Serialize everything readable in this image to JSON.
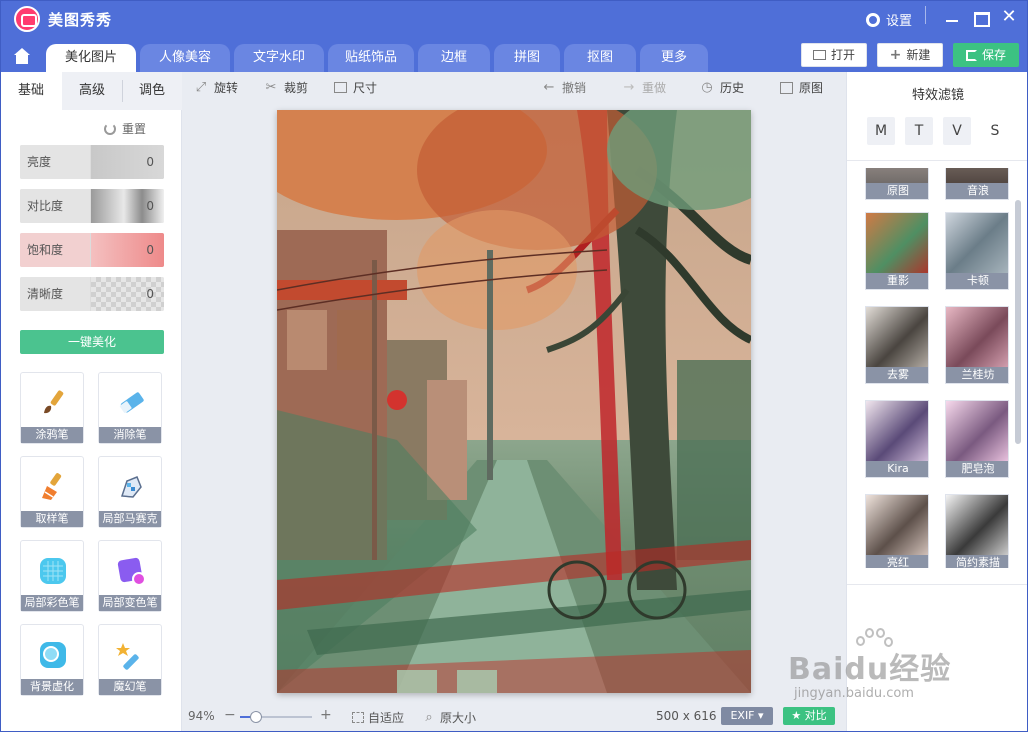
{
  "app": {
    "title": "美图秀秀",
    "settings_label": "设置"
  },
  "tabs": [
    {
      "label": "美化图片",
      "active": true
    },
    {
      "label": "人像美容"
    },
    {
      "label": "文字水印"
    },
    {
      "label": "贴纸饰品"
    },
    {
      "label": "边框"
    },
    {
      "label": "拼图"
    },
    {
      "label": "抠图"
    },
    {
      "label": "更多"
    }
  ],
  "top_buttons": {
    "open": "打开",
    "new": "新建",
    "save": "保存"
  },
  "left": {
    "subtabs": [
      "基础",
      "高级",
      "调色"
    ],
    "reset_label": "重置",
    "sliders": [
      {
        "label": "亮度",
        "value": "0"
      },
      {
        "label": "对比度",
        "value": "0"
      },
      {
        "label": "饱和度",
        "value": "0"
      },
      {
        "label": "清晰度",
        "value": "0"
      }
    ],
    "one_click_label": "一键美化",
    "tools": [
      {
        "label": "涂鸦笔",
        "icon": "brush-icon"
      },
      {
        "label": "消除笔",
        "icon": "eraser-icon"
      },
      {
        "label": "取样笔",
        "icon": "sample-brush-icon"
      },
      {
        "label": "局部马赛克",
        "icon": "mosaic-pen-icon"
      },
      {
        "label": "局部彩色笔",
        "icon": "color-pen-icon"
      },
      {
        "label": "局部变色笔",
        "icon": "recolor-pen-icon"
      },
      {
        "label": "背景虚化",
        "icon": "blur-bg-icon"
      },
      {
        "label": "魔幻笔",
        "icon": "magic-pen-icon"
      }
    ]
  },
  "toolbar": {
    "rotate": "旋转",
    "crop": "裁剪",
    "size": "尺寸",
    "undo": "撤销",
    "redo": "重做",
    "history": "历史",
    "original": "原图"
  },
  "status": {
    "zoom": "94%",
    "zoom_fraction": 0.22,
    "fit": "自适应",
    "actual_size": "原大小",
    "image_size": "500 x 616",
    "exif": "EXIF",
    "compare": "对比"
  },
  "right": {
    "title": "特效滤镜",
    "tabs": [
      "M",
      "T",
      "V",
      "S"
    ],
    "filters": [
      {
        "label": "原图"
      },
      {
        "label": "音浪"
      },
      {
        "label": "重影"
      },
      {
        "label": "卡顿"
      },
      {
        "label": "去雾"
      },
      {
        "label": "兰桂坊"
      },
      {
        "label": "Kira"
      },
      {
        "label": "肥皂泡"
      },
      {
        "label": "亮红"
      },
      {
        "label": "简约素描"
      }
    ]
  },
  "watermark": {
    "main": "Baidu经验",
    "sub": "jingyan.baidu.com"
  },
  "colors": {
    "brand": "#4f6fd8",
    "accent_green": "#3cc282",
    "label_gray": "#8a93a6"
  }
}
